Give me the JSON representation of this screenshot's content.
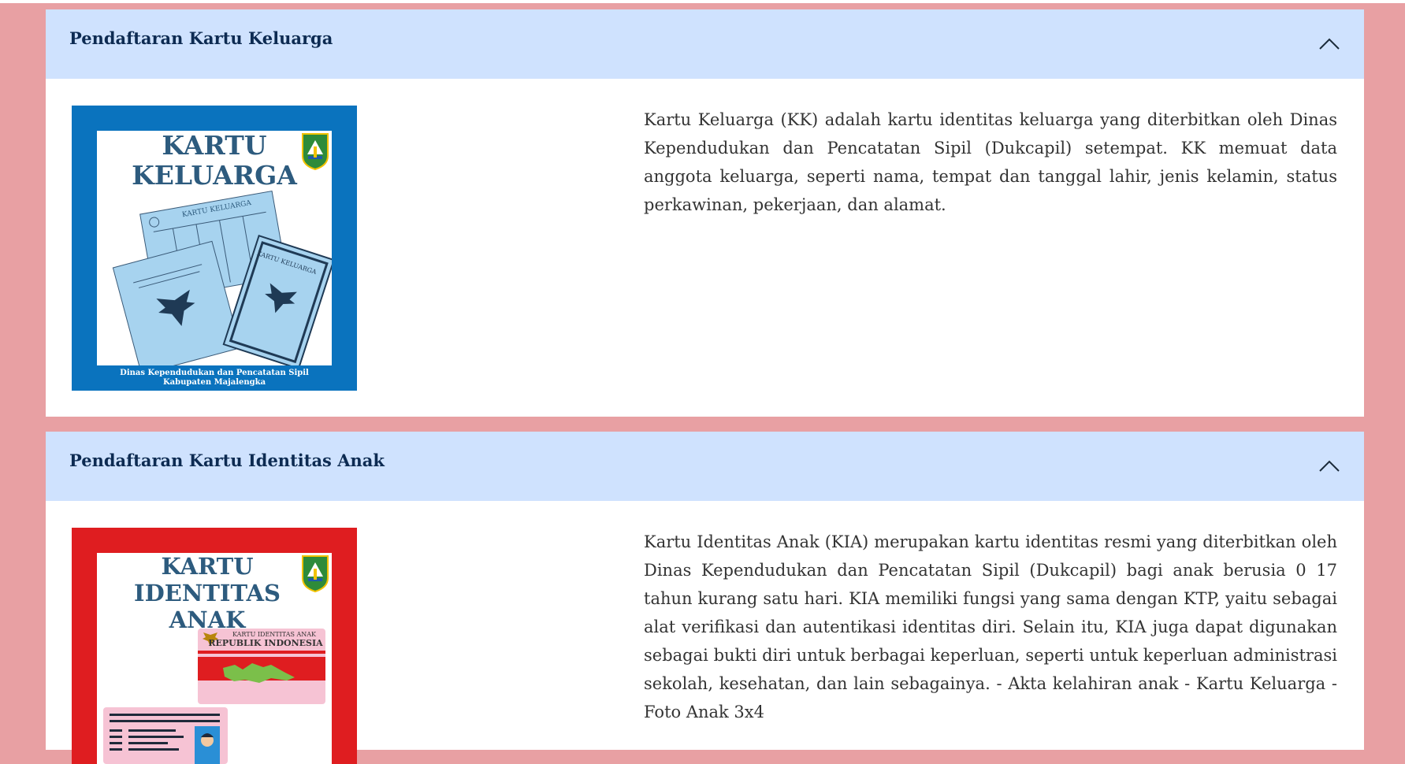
{
  "panels": [
    {
      "title": "Pendaftaran Kartu Keluarga",
      "description": "Kartu Keluarga (KK) adalah kartu identitas keluarga yang diterbitkan oleh Dinas Kependudukan dan Pencatatan Sipil (Dukcapil) setempat. KK memuat data anggota keluarga, seperti nama, tempat dan tanggal lahir, jenis kelamin, status perkawinan, pekerjaan, dan alamat.",
      "image": {
        "title_line1": "KARTU",
        "title_line2": "KELUARGA",
        "card_label_1": "KARTU KELUARGA",
        "card_label_2": "KARTU KELUARGA",
        "footer_line1": "Dinas Kependudukan dan Pencatatan Sipil",
        "footer_line2": "Kabupaten Majalengka",
        "frame_color": "#0a73be"
      }
    },
    {
      "title": "Pendaftaran Kartu Identitas Anak",
      "description": "Kartu Identitas Anak (KIA) merupakan kartu identitas resmi yang diterbitkan oleh Dinas Kependudukan dan Pencatatan Sipil (Dukcapil) bagi anak berusia 0 17 tahun kurang satu hari. KIA memiliki fungsi yang sama dengan KTP, yaitu sebagai alat verifikasi dan autentikasi identitas diri. Selain itu, KIA juga dapat digunakan sebagai bukti diri untuk berbagai keperluan, seperti untuk keperluan administrasi sekolah, kesehatan, dan lain sebagainya. - Akta kelahiran anak - Kartu Keluarga - Foto Anak 3x4",
      "image": {
        "title_line1": "KARTU",
        "title_line2": "IDENTITAS",
        "title_line3": "ANAK",
        "card_label_1": "KARTU IDENTITAS ANAK",
        "card_label_2": "REPUBLIK INDONESIA",
        "frame_color": "#df1d20"
      }
    }
  ],
  "colors": {
    "background": "#e8a0a3",
    "header": "#cfe2fe",
    "title": "#0d2b52"
  },
  "icons": {
    "toggle": "chevron-up-icon",
    "emblem": "garuda-emblem-icon",
    "regency_logo": "majalengka-logo-icon"
  }
}
